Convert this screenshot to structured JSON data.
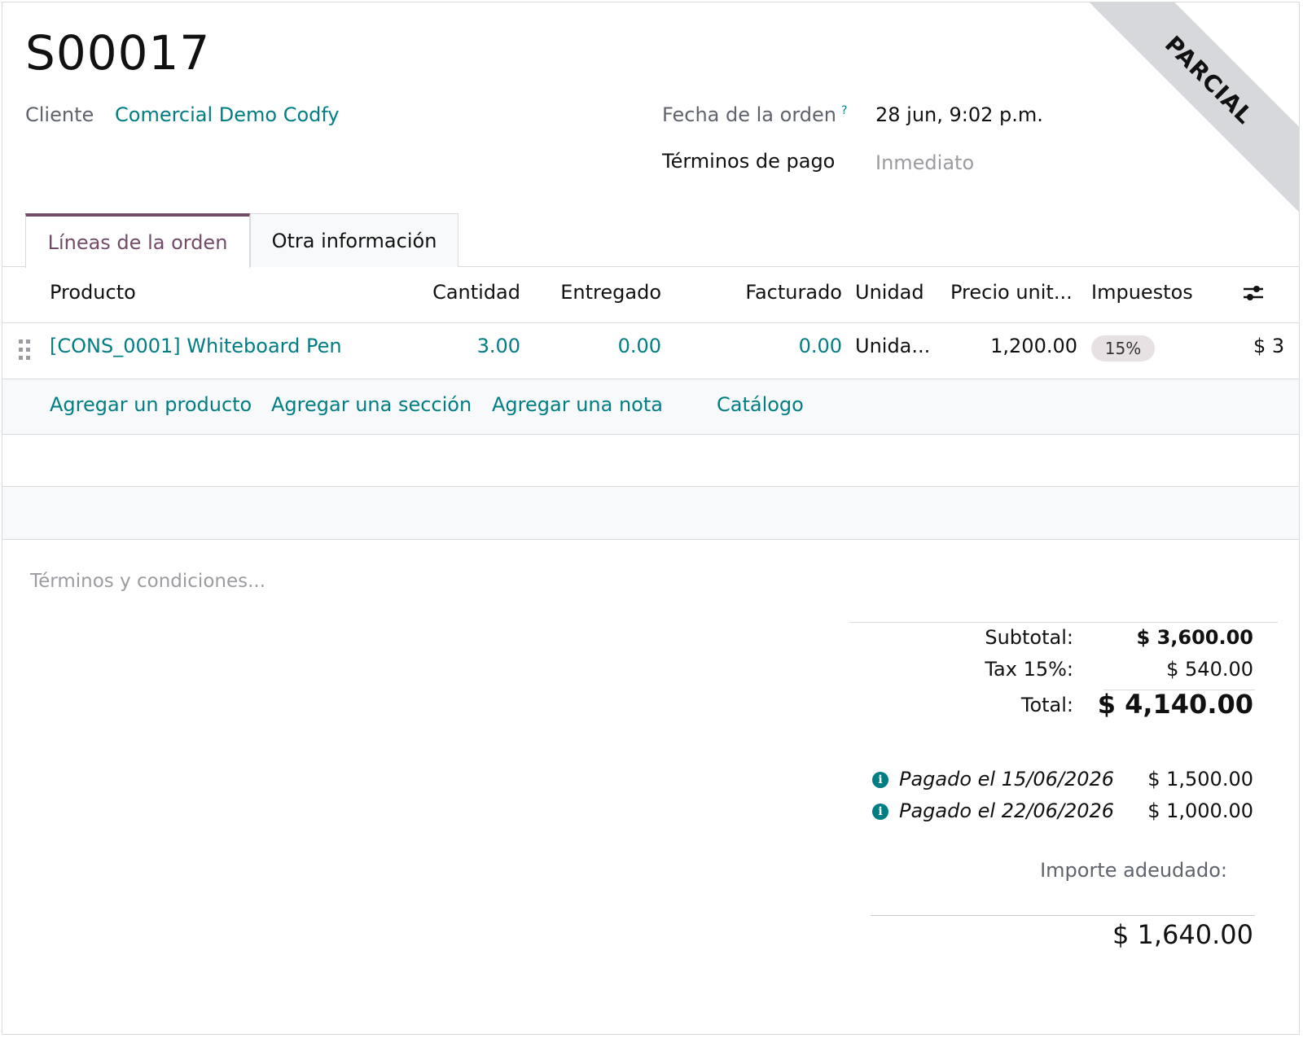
{
  "order": {
    "name": "S00017",
    "ribbon": "PARCIAL",
    "customer_label": "Cliente",
    "customer_value": "Comercial Demo Codfy",
    "date_label": "Fecha de la orden",
    "date_help": "?",
    "date_value": "28 jun, 9:02 p.m.",
    "terms_label": "Términos de pago",
    "terms_value": "Inmediato"
  },
  "tabs": [
    {
      "label": "Líneas de la orden",
      "active": true
    },
    {
      "label": "Otra información",
      "active": false
    }
  ],
  "table": {
    "headers": {
      "product": "Producto",
      "quantity": "Cantidad",
      "delivered": "Entregado",
      "invoiced": "Facturado",
      "uom": "Unidad",
      "price": "Precio unit...",
      "taxes": "Impuestos"
    },
    "optional_columns_icon": "sliders-icon",
    "rows": [
      {
        "product": "[CONS_0001] Whiteboard Pen",
        "quantity": "3.00",
        "delivered": "0.00",
        "invoiced": "0.00",
        "uom": "Unida...",
        "price": "1,200.00",
        "tax": "15%",
        "subtotal": "$ 3"
      }
    ],
    "add_links": {
      "product": "Agregar un producto",
      "section": "Agregar una sección",
      "note": "Agregar una nota",
      "catalog": "Catálogo"
    }
  },
  "terms_placeholder": "Términos y condiciones...",
  "totals": {
    "subtotal_label": "Subtotal:",
    "subtotal_value": "$ 3,600.00",
    "tax_label": "Tax 15%:",
    "tax_value": "$ 540.00",
    "total_label": "Total:",
    "total_value": "$ 4,140.00",
    "payments": [
      {
        "label": "Pagado el 15/06/2026",
        "amount": "$ 1,500.00"
      },
      {
        "label": "Pagado el 22/06/2026",
        "amount": "$ 1,000.00"
      }
    ],
    "due_label": "Importe adeudado:",
    "due_value": "$ 1,640.00"
  },
  "colors": {
    "accent": "#714b67",
    "link": "#017e84",
    "ribbon": "#d7d8db"
  }
}
